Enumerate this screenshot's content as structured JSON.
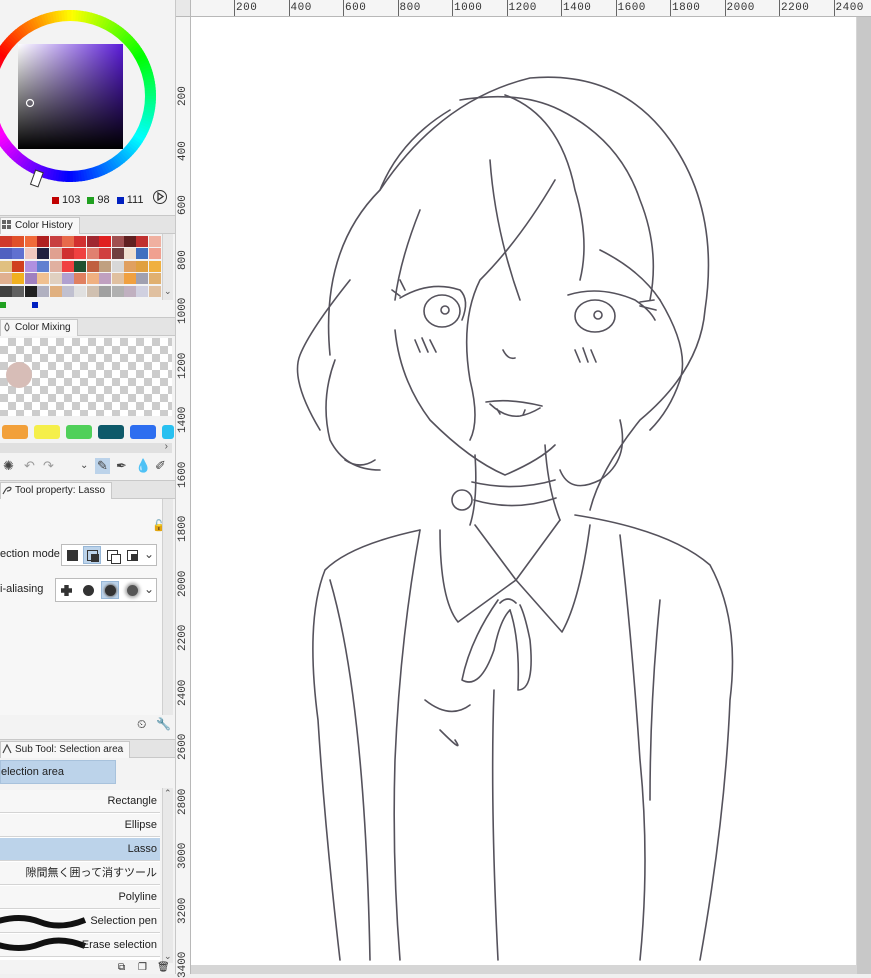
{
  "color": {
    "r_value": "103",
    "g_value": "98",
    "b_value": "111",
    "r_color": "#c00000",
    "g_color": "#20a020",
    "b_color": "#0020c0",
    "current_color": "#67626f"
  },
  "panels": {
    "color_history": "Color History",
    "color_mixing": "Color Mixing",
    "tool_property": "Tool property: Lasso",
    "sub_tool": "Sub Tool: Selection area"
  },
  "tool_property": {
    "selection_mode_label": "ection mode",
    "anti_aliasing_label": "i-aliasing"
  },
  "sub_tool": {
    "group_label": "election area",
    "items": [
      {
        "label": "Rectangle"
      },
      {
        "label": "Ellipse"
      },
      {
        "label": "Lasso"
      },
      {
        "label": "隙間無く囲って消すツール"
      },
      {
        "label": "Polyline"
      },
      {
        "label": "Selection pen"
      },
      {
        "label": "Erase selection"
      }
    ]
  },
  "ruler": {
    "top": [
      "200",
      "400",
      "600",
      "800",
      "1000",
      "1200",
      "1400",
      "1600",
      "1800",
      "2000",
      "2200",
      "2400"
    ],
    "left": [
      "200",
      "400",
      "600",
      "800",
      "1000",
      "1200",
      "1400",
      "1600",
      "1800",
      "2000",
      "2200",
      "2400",
      "2600",
      "2800",
      "3000",
      "3200",
      "3400"
    ]
  },
  "icons": {
    "tool_property_icon": "lasso-icon",
    "sub_tool_icon": "selection-icon",
    "mixing_icon": "droplet-icon",
    "history_icon": "palette-grid-icon"
  },
  "accent": "#bcd3ea"
}
